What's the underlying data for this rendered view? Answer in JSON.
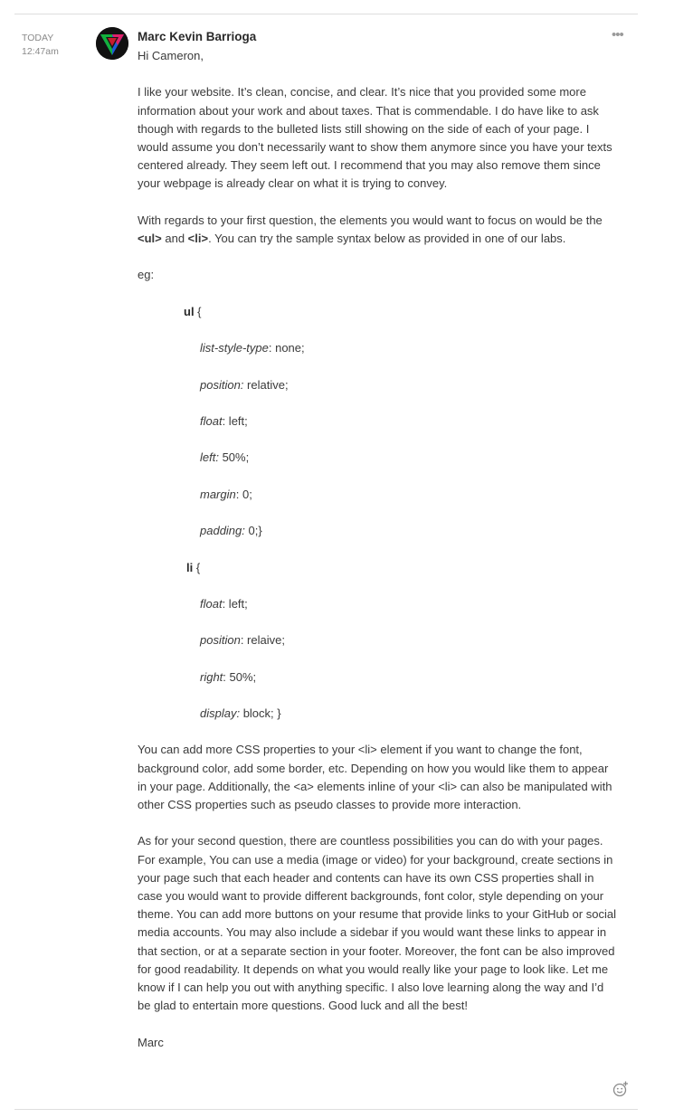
{
  "post": {
    "time_day": "TODAY",
    "time_clock": "12:47am",
    "author": "Marc Kevin Barrioga",
    "more_label": "•••",
    "greeting": "Hi Cameron,",
    "para1": "I like your website. It’s clean, concise, and clear. It’s nice that you provided some more information about your work and about taxes. That is commendable. I do have like to ask though with regards to the bulleted lists still showing on the side of each of your page. I would assume you don’t necessarily want to show them anymore since you have your texts centered already. They seem left out. I recommend that you may also remove them since your webpage is already clear on what it is trying to convey.",
    "para2": {
      "pre": "With regards to your first  question, the elements you would want to focus on would be the ",
      "tag_ul": "<ul>",
      "mid": " and ",
      "tag_li": "<li>",
      "post": ". You can try the sample syntax below as provided in one of our labs."
    },
    "eg_label": "eg:",
    "code": {
      "ul_selector": "ul",
      "ul_brace": " {",
      "ul_rules": [
        {
          "prop": "list-style-type",
          "value": ": none;"
        },
        {
          "prop": "position:",
          "value": " relative;"
        },
        {
          "prop": "float",
          "value": ": left;"
        },
        {
          "prop": "left:",
          "value": " 50%;"
        },
        {
          "prop": "margin",
          "value": ": 0;"
        },
        {
          "prop": "padding:",
          "value": " 0;}"
        }
      ],
      "li_selector": "li",
      "li_brace": " {",
      "li_rules": [
        {
          "prop": "float",
          "value": ": left;"
        },
        {
          "prop": "position",
          "value": ": relaive;"
        },
        {
          "prop": "right",
          "value": ": 50%;"
        },
        {
          "prop": "display:",
          "value": " block; }"
        }
      ]
    },
    "para3": "You can add more CSS properties to your <li> element if you want to change the font, background color, add some border, etc. Depending on how you would like them to appear in your page. Additionally, the <a> elements inline of your <li> can also be manipulated with other CSS properties such as pseudo classes to provide more interaction.",
    "para4": "As for your second question, there are countless possibilities you can do with your pages. For example, You can use a media (image or video) for your background, create sections in your page such that each header and contents can have its own CSS properties shall in case you would want to provide different backgrounds, font color, style depending on your theme. You can add more buttons on your resume that provide links to your GitHub or social media accounts. You may also include a sidebar if you would want these links to appear in that section, or at a separate section in your footer. Moreover, the font can be also improved for good readability. It depends on what you would really like your page to look like. Let me know if I can help you out with anything specific. I also love learning along the way and I’d be glad to entertain more questions. Good luck and all the best!",
    "signoff": "Marc"
  },
  "icons": {
    "avatar": "avatar-logo",
    "more": "more-options-icon",
    "reaction": "add-reaction-icon"
  }
}
